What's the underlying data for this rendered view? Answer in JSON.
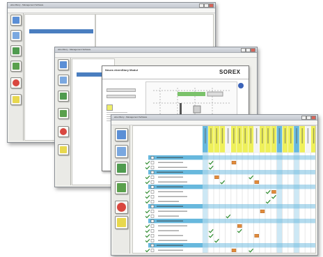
{
  "window1": {
    "title": "ekrenStory - Management Software"
  },
  "window2": {
    "title": "ekrenStory - Management Software"
  },
  "window3": {
    "title": "ekrenStory - Management Software"
  },
  "dialog": {
    "title": "Neues ekrenStory Modul",
    "brand": "SOREX"
  },
  "icons": [
    "door-icon",
    "door-keys-icon",
    "person-icon",
    "calendar-icon",
    "power-icon",
    "report-icon"
  ],
  "colors": {
    "blue_header": "#67b8dd",
    "yellow_header": "#eef05a",
    "selection": "#4a7ec0",
    "check": "#2d8a2d",
    "orange": "#e28b3b"
  },
  "grid": {
    "rows": [
      {
        "type": "group"
      },
      {
        "type": "item"
      },
      {
        "type": "item"
      },
      {
        "type": "group"
      },
      {
        "type": "item"
      },
      {
        "type": "item"
      },
      {
        "type": "group"
      },
      {
        "type": "item"
      },
      {
        "type": "item"
      },
      {
        "type": "item"
      },
      {
        "type": "group"
      },
      {
        "type": "item"
      },
      {
        "type": "item"
      },
      {
        "type": "group"
      },
      {
        "type": "item"
      },
      {
        "type": "item"
      },
      {
        "type": "item"
      },
      {
        "type": "item"
      },
      {
        "type": "group"
      },
      {
        "type": "item"
      },
      {
        "type": "item"
      }
    ],
    "columns": [
      "blue",
      "yellow",
      "yellow",
      "yellow",
      "white",
      "yellow",
      "yellow",
      "yellow",
      "yellow",
      "white",
      "yellow",
      "yellow",
      "yellow",
      "blue",
      "yellow",
      "yellow",
      "blue",
      "yellow",
      "white",
      "yellow"
    ],
    "marks": [
      [
        1,
        1,
        "check"
      ],
      [
        1,
        5,
        "orange"
      ],
      [
        2,
        1,
        "check"
      ],
      [
        4,
        2,
        "orange"
      ],
      [
        4,
        8,
        "check"
      ],
      [
        5,
        3,
        "check"
      ],
      [
        5,
        9,
        "orange"
      ],
      [
        7,
        11,
        "check"
      ],
      [
        7,
        12,
        "orange"
      ],
      [
        8,
        12,
        "check"
      ],
      [
        9,
        11,
        "check"
      ],
      [
        11,
        10,
        "orange"
      ],
      [
        12,
        4,
        "check"
      ],
      [
        14,
        6,
        "orange"
      ],
      [
        15,
        1,
        "check"
      ],
      [
        15,
        6,
        "check"
      ],
      [
        16,
        1,
        "check"
      ],
      [
        16,
        9,
        "orange"
      ],
      [
        17,
        2,
        "check"
      ],
      [
        19,
        5,
        "orange"
      ],
      [
        19,
        8,
        "check"
      ]
    ]
  }
}
